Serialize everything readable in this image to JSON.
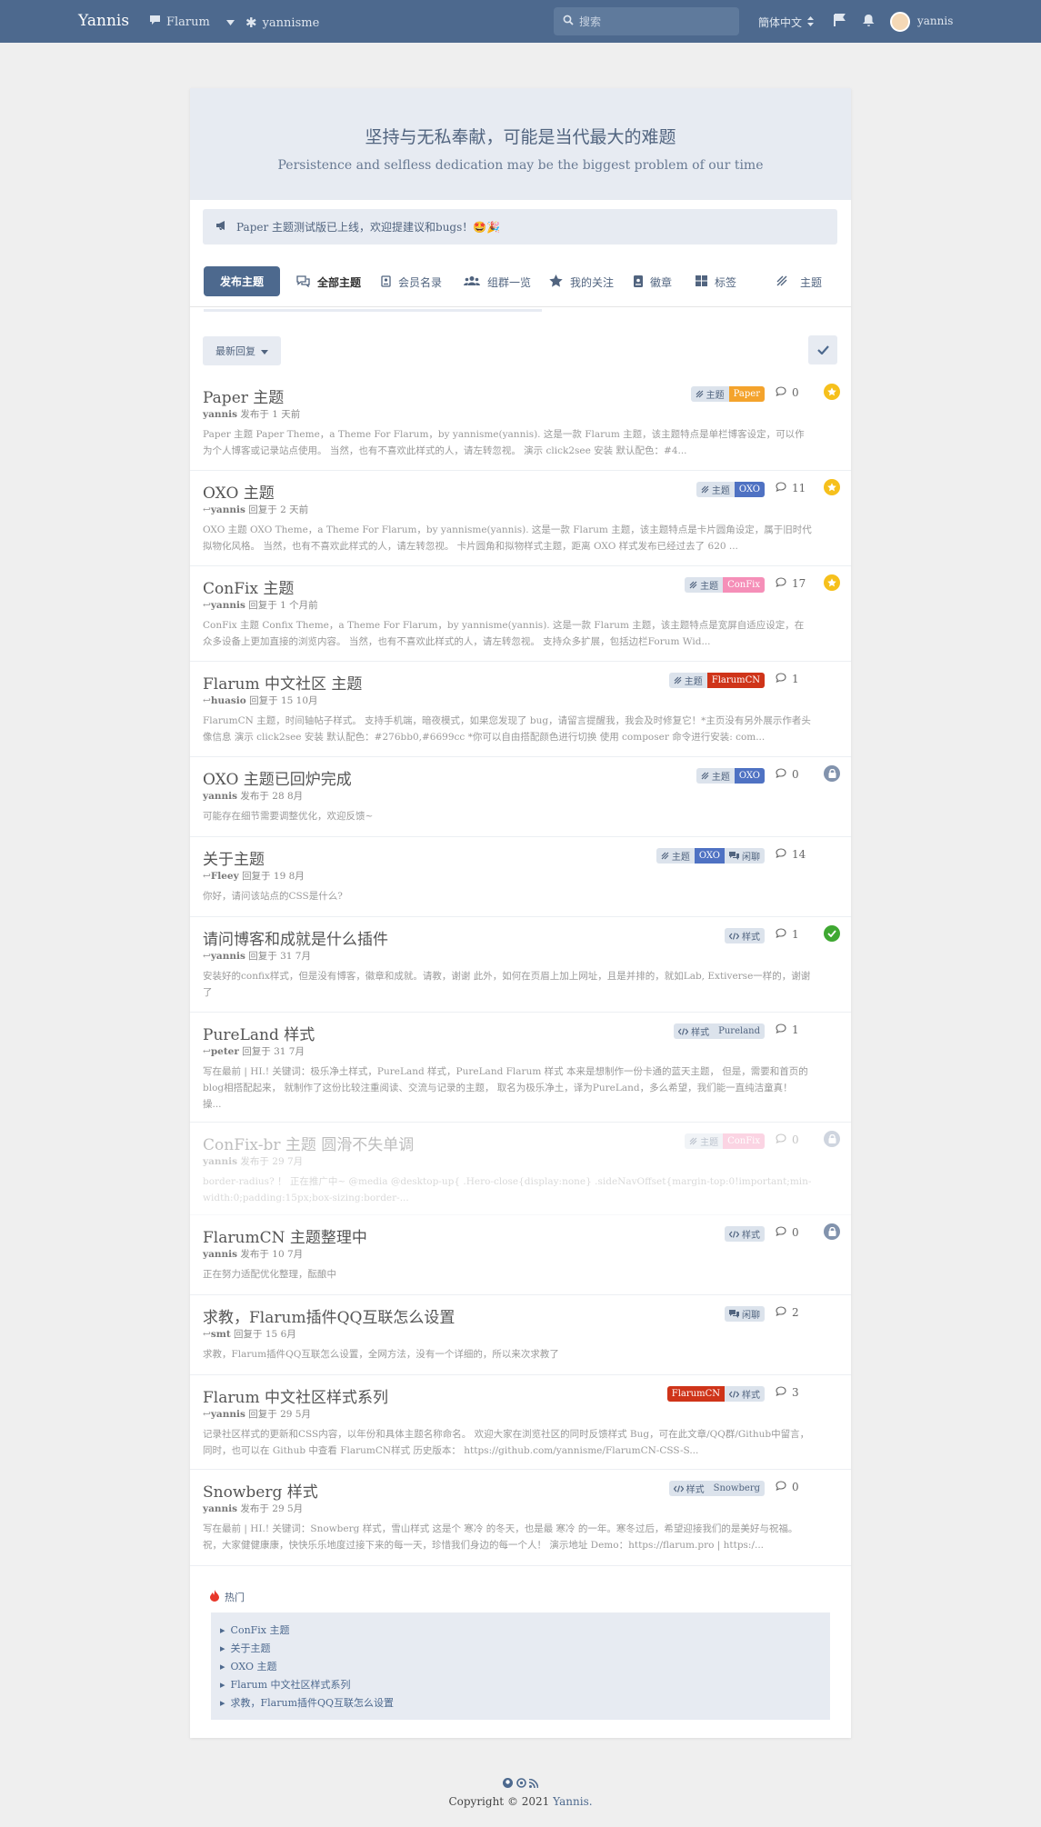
{
  "header": {
    "brand": "Yannis",
    "nav_flarum": "Flarum",
    "nav_yannisme": "yannisme",
    "search_placeholder": "搜索",
    "language": "簡体中文",
    "username": "yannis"
  },
  "hero": {
    "title": "坚持与无私奉献，可能是当代最大的难题",
    "subtitle": "Persistence and selfless dedication may be the biggest problem of our time"
  },
  "notice": "Paper 主题测试版已上线，欢迎提建议和bugs！🤩🎉",
  "toolbar": {
    "post_button": "发布主题",
    "nav": [
      "全部主题",
      "会员名录",
      "组群一览",
      "我的关注",
      "徽章",
      "标签",
      "主题"
    ]
  },
  "sort_label": "最新回复",
  "discussions": [
    {
      "title": "Paper 主题",
      "user": "yannis",
      "action": "发布于 1 天前",
      "reply": false,
      "excerpt": "Paper 主题 Paper Theme，a Theme For Flarum，by yannisme(yannis). 这是一款 Flarum 主题，该主题特点是单栏博客设定，可以作为个人博客或记录站点使用。 当然，也有不喜欢此样式的人，请左转忽视。 演示 click2see 安装 默认配色：#4...",
      "tags": [
        {
          "label": "主题",
          "kind": "theme"
        },
        {
          "label": "Paper",
          "kind": "paper"
        }
      ],
      "count": "0",
      "badge": "star"
    },
    {
      "title": "OXO 主题",
      "user": "yannis",
      "action": "回复于 2 天前",
      "reply": true,
      "excerpt": "OXO 主题 OXO Theme，a Theme For Flarum，by yannisme(yannis). 这是一款 Flarum 主题，该主题特点是卡片圆角设定，属于旧时代拟物化风格。 当然，也有不喜欢此样式的人，请左转忽视。 卡片圆角和拟物样式主题，距离 OXO 样式发布已经过去了 620 ...",
      "tags": [
        {
          "label": "主题",
          "kind": "theme"
        },
        {
          "label": "OXO",
          "kind": "oxo-end"
        }
      ],
      "count": "11",
      "badge": "star"
    },
    {
      "title": "ConFix 主题",
      "user": "yannis",
      "action": "回复于 1 个月前",
      "reply": true,
      "excerpt": "ConFix 主题 Confix Theme，a Theme For Flarum，by yannisme(yannis). 这是一款 Flarum 主题，该主题特点是宽屏自适应设定，在众多设备上更加直接的浏览内容。 当然，也有不喜欢此样式的人，请左转忽视。 支持众多扩展，包括边栏Forum Wid...",
      "tags": [
        {
          "label": "主题",
          "kind": "theme"
        },
        {
          "label": "ConFix",
          "kind": "confix"
        }
      ],
      "count": "17",
      "badge": "star"
    },
    {
      "title": "Flarum 中文社区 主题",
      "user": "huasio",
      "action": "回复于 15 10月",
      "reply": true,
      "excerpt": "FlarumCN 主题，时间轴帖子样式。 支持手机端，暗夜模式，如果您发现了 bug，请留言提醒我，我会及时修复它！*主页没有另外展示作者头像信息 演示 click2see 安装 默认配色：#276bb0,#6699cc *你可以自由搭配颜色进行切换 使用 composer 命令进行安装: com...",
      "tags": [
        {
          "label": "主题",
          "kind": "theme"
        },
        {
          "label": "FlarumCN",
          "kind": "fcn"
        }
      ],
      "count": "1",
      "badge": ""
    },
    {
      "title": "OXO 主题已回炉完成",
      "user": "yannis",
      "action": "发布于 28 8月",
      "reply": false,
      "excerpt": "可能存在细节需要调整优化，欢迎反馈~",
      "tags": [
        {
          "label": "主题",
          "kind": "theme"
        },
        {
          "label": "OXO",
          "kind": "oxo-end"
        }
      ],
      "count": "0",
      "badge": "lock"
    },
    {
      "title": "关于主题",
      "user": "Fleey",
      "action": "回复于 19 8月",
      "reply": true,
      "excerpt": "你好，请问该站点的CSS是什么?",
      "tags": [
        {
          "label": "主题",
          "kind": "theme"
        },
        {
          "label": "OXO",
          "kind": "oxo"
        },
        {
          "label": "闲聊",
          "kind": "chat"
        }
      ],
      "count": "14",
      "badge": ""
    },
    {
      "title": "请问博客和成就是什么插件",
      "user": "yannis",
      "action": "回复于 31 7月",
      "reply": true,
      "excerpt": "安装好的confix样式，但是没有博客，徽章和成就。请教，谢谢 此外，如何在页眉上加上网址，且是并排的，就如Lab, Extiverse一样的，谢谢了",
      "tags": [
        {
          "label": "样式",
          "kind": "style"
        }
      ],
      "count": "1",
      "badge": "ok"
    },
    {
      "title": "PureLand 样式",
      "user": "peter",
      "action": "回复于 31 7月",
      "reply": true,
      "excerpt": "写在最前 | HI.! 关键词：极乐净土样式，PureLand 样式，PureLand Flarum 样式 本来是想制作一份卡通的蓝天主题， 但是，需要和首页的blog相搭配起来， 就制作了这份比较注重阅读、交流与记录的主题， 取名为极乐净土，译为PureLand，多么希望，我们能一直纯洁童真！ 操...",
      "tags": [
        {
          "label": "样式",
          "kind": "style-start"
        },
        {
          "label": "Pureland",
          "kind": "pure"
        }
      ],
      "count": "1",
      "badge": ""
    },
    {
      "title": "ConFix-br 主题 圆滑不失单调",
      "user": "yannis",
      "action": "发布于 29 7月",
      "reply": false,
      "faded": true,
      "excerpt": "border-radius? ！ 正在推广中~ @media @desktop-up{ .Hero-close{display:none} .sideNavOffset{margin-top:0!important;min-width:0;padding:15px;box-sizing:border-...",
      "tags": [
        {
          "label": "主题",
          "kind": "theme"
        },
        {
          "label": "ConFix",
          "kind": "confix"
        }
      ],
      "count": "0",
      "badge": "lock"
    },
    {
      "title": "FlarumCN 主题整理中",
      "user": "yannis",
      "action": "发布于 10 7月",
      "reply": false,
      "excerpt": "正在努力适配优化整理，酝酿中",
      "tags": [
        {
          "label": "样式",
          "kind": "style"
        }
      ],
      "count": "0",
      "badge": "lock"
    },
    {
      "title": "求教，Flarum插件QQ互联怎么设置",
      "user": "smt",
      "action": "回复于 15 6月",
      "reply": true,
      "excerpt": "求教，Flarum插件QQ互联怎么设置，全网方法，没有一个详细的，所以来次求教了",
      "tags": [
        {
          "label": "闲聊",
          "kind": "chat-solo"
        }
      ],
      "count": "2",
      "badge": ""
    },
    {
      "title": "Flarum 中文社区样式系列",
      "user": "yannis",
      "action": "回复于 29 5月",
      "reply": true,
      "excerpt": "记录社区样式的更新和CSS内容，以年份和具体主题名称命名。 欢迎大家在浏览社区的同时反馈样式 Bug，可在此文章/QQ群/Github中留言， 同时，也可以在 Github 中查看 FlarumCN样式 历史版本： https://github.com/yannisme/FlarumCN-CSS-S...",
      "tags": [
        {
          "label": "FlarumCN",
          "kind": "fcn-start"
        },
        {
          "label": "样式",
          "kind": "style-end"
        }
      ],
      "count": "3",
      "badge": ""
    },
    {
      "title": "Snowberg 样式",
      "user": "yannis",
      "action": "发布于 29 5月",
      "reply": false,
      "excerpt": "写在最前 | HI.! 关键词：Snowberg 样式，雪山样式 这是个 寒冷 的冬天，也是最 寒冷 的一年。寒冬过后，希望迎接我们的是美好与祝福。 祝，大家健健康康，快快乐乐地度过接下来的每一天，珍惜我们身边的每一个人！ 演示地址 Demo：https://flarum.pro | https:/...",
      "tags": [
        {
          "label": "样式",
          "kind": "style-start"
        },
        {
          "label": "Snowberg",
          "kind": "pure"
        }
      ],
      "count": "0",
      "badge": ""
    }
  ],
  "hot": {
    "title": "热门",
    "items": [
      "ConFix 主题",
      "关于主题",
      "OXO 主题",
      "Flarum 中文社区样式系列",
      "求教，Flarum插件QQ互联怎么设置"
    ]
  },
  "footer": {
    "copyright": "Copyright © 2021",
    "link": "Yannis."
  }
}
